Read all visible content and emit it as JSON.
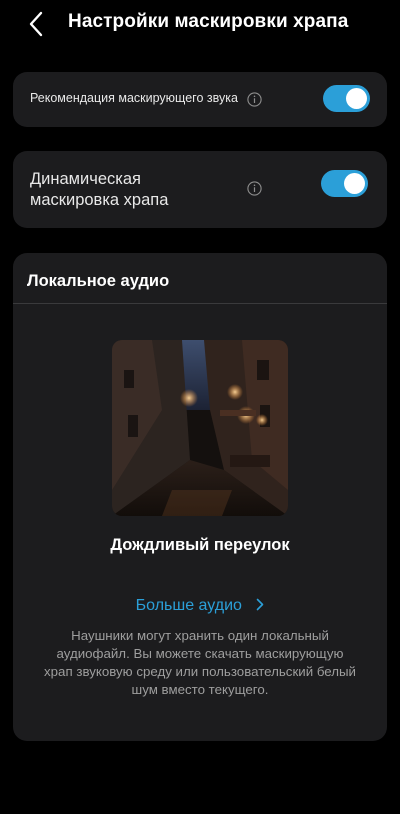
{
  "header": {
    "title": "Настройки маскировки храпа"
  },
  "settings": {
    "recommendation": {
      "label": "Рекомендация маскирующего звука",
      "enabled": true
    },
    "dynamic_masking": {
      "label": "Динамическая маскировка храпа",
      "enabled": true
    }
  },
  "local_audio": {
    "title": "Локальное аудио",
    "track_name": "Дождливый переулок",
    "more_audio_label": "Больше аудио",
    "description": "Наушники могут хранить один локальный аудиофайл. Вы можете скачать маскирующую храп звуковую среду или пользовательский белый шум вместо текущего."
  },
  "colors": {
    "background": "#000000",
    "card": "#1c1c1e",
    "accent": "#2b9fd8",
    "secondary_text": "#9e9e9e"
  },
  "icons": {
    "back": "chevron-left-icon",
    "info": "info-icon",
    "more": "chevron-right-icon"
  }
}
